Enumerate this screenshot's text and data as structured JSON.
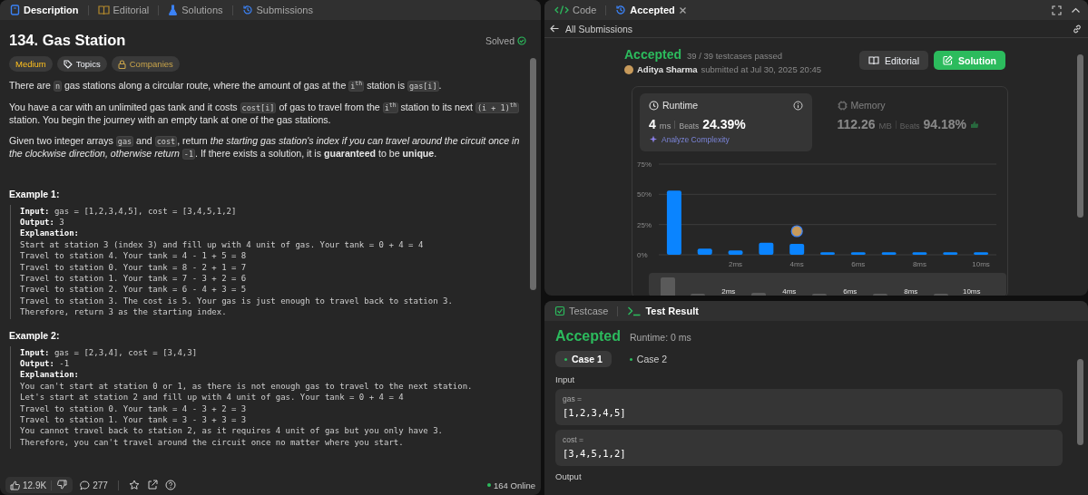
{
  "left_panel": {
    "tabs": [
      {
        "label": "Description",
        "selected": true,
        "kind": "description"
      },
      {
        "label": "Editorial",
        "selected": false,
        "kind": "editorial"
      },
      {
        "label": "Solutions",
        "selected": false,
        "kind": "solutions"
      },
      {
        "label": "Submissions",
        "selected": false,
        "kind": "submissions"
      }
    ],
    "problem": {
      "title": "134. Gas Station",
      "status": "Solved",
      "tags": [
        {
          "label": "Medium",
          "kind": "difficulty"
        },
        {
          "label": "Topics",
          "kind": "topics"
        },
        {
          "label": "Companies",
          "kind": "companies"
        }
      ],
      "paragraphs": [
        [
          {
            "kind": "text",
            "text": "There are "
          },
          {
            "kind": "code",
            "text": "n"
          },
          {
            "kind": "text",
            "text": " gas stations along a circular route, where the amount of gas at the "
          },
          {
            "kind": "code",
            "text": "i$^{th}$"
          },
          {
            "kind": "text",
            "text": " station is "
          },
          {
            "kind": "code",
            "text": "gas[i]"
          },
          {
            "kind": "text",
            "text": "."
          }
        ],
        [
          {
            "kind": "text",
            "text": "You have a car with an unlimited gas tank and it costs "
          },
          {
            "kind": "code",
            "text": "cost[i]"
          },
          {
            "kind": "text",
            "text": " of gas to travel from the "
          },
          {
            "kind": "code",
            "text": "i$^{th}$"
          },
          {
            "kind": "text",
            "text": " station to its next "
          },
          {
            "kind": "code",
            "text": "(i + 1)$^{th}$"
          },
          {
            "kind": "text",
            "text": " station. You begin the journey with an empty tank at one of the gas stations."
          }
        ],
        [
          {
            "kind": "text",
            "text": "Given two integer arrays "
          },
          {
            "kind": "code",
            "text": "gas"
          },
          {
            "kind": "text",
            "text": " and "
          },
          {
            "kind": "code",
            "text": "cost"
          },
          {
            "kind": "text",
            "text": ", return *the starting gas station's index if you can travel around the circuit once in the clockwise direction, otherwise return* "
          },
          {
            "kind": "code",
            "text": "-1"
          },
          {
            "kind": "text",
            "text": ". If there exists a solution, it is **guaranteed** to be **unique**."
          }
        ]
      ],
      "examples": [
        {
          "heading": "Example 1:",
          "lines": [
            "**Input:** gas = [1,2,3,4,5], cost = [3,4,5,1,2]",
            "**Output:** 3",
            "**Explanation:**",
            "Start at station 3 (index 3) and fill up with 4 unit of gas. Your tank = 0 + 4 = 4",
            "Travel to station 4. Your tank = 4 - 1 + 5 = 8",
            "Travel to station 0. Your tank = 8 - 2 + 1 = 7",
            "Travel to station 1. Your tank = 7 - 3 + 2 = 6",
            "Travel to station 2. Your tank = 6 - 4 + 3 = 5",
            "Travel to station 3. The cost is 5. Your gas is just enough to travel back to station 3.",
            "Therefore, return 3 as the starting index."
          ]
        },
        {
          "heading": "Example 2:",
          "lines": [
            "**Input:** gas = [2,3,4], cost = [3,4,3]",
            "**Output:** -1",
            "**Explanation:**",
            "You can't start at station 0 or 1, as there is not enough gas to travel to the next station.",
            "Let's start at station 2 and fill up with 4 unit of gas. Your tank = 0 + 4 = 4",
            "Travel to station 0. Your tank = 4 - 3 + 2 = 3",
            "Travel to station 1. Your tank = 3 - 3 + 3 = 3",
            "You cannot travel back to station 2, as it requires 4 unit of gas but you only have 3.",
            "Therefore, you can't travel around the circuit once no matter where you start."
          ]
        }
      ]
    },
    "footer": {
      "likes": "12.9K",
      "comments": "277",
      "online": "164 Online"
    }
  },
  "right_panel": {
    "tabs": [
      {
        "label": "Code",
        "selected": false,
        "kind": "code"
      },
      {
        "label": "Accepted",
        "selected": true,
        "kind": "result"
      }
    ],
    "back_link": "All Submissions",
    "submission": {
      "status": "Accepted",
      "passed": "39 / 39 testcases passed",
      "author": "Aditya Sharma",
      "submitted": "submitted at Jul 30, 2025 20:45",
      "buttons": [
        {
          "label": "Editorial",
          "kind": "secondary"
        },
        {
          "label": "Solution",
          "kind": "primary"
        }
      ],
      "metrics": [
        {
          "label": "Runtime",
          "kind": "runtime",
          "value": "4",
          "unit": "ms",
          "beats_label": "Beats",
          "beats": "24.39%",
          "selected": true,
          "link": "Analyze Complexity"
        },
        {
          "label": "Memory",
          "kind": "memory",
          "value": "112.26",
          "unit": "MB",
          "beats_label": "Beats",
          "beats": "94.18%",
          "selected": false
        }
      ],
      "chart_data": {
        "type": "bar",
        "x": [
          0,
          1,
          2,
          3,
          4,
          5,
          6,
          7,
          8,
          9,
          10
        ],
        "values": [
          53,
          5,
          3.5,
          10,
          9,
          2,
          2,
          2,
          2,
          2,
          2
        ],
        "xlim": [
          -0.5,
          10.5
        ],
        "ylim": [
          0,
          75
        ],
        "yticks": [
          {
            "value": 0,
            "label": "0%"
          },
          {
            "value": 25,
            "label": "25%"
          },
          {
            "value": 50,
            "label": "50%"
          },
          {
            "value": 75,
            "label": "75%"
          }
        ],
        "xticks": [
          {
            "value": 2,
            "label": "2ms"
          },
          {
            "value": 4,
            "label": "4ms"
          },
          {
            "value": 6,
            "label": "6ms"
          },
          {
            "value": 8,
            "label": "8ms"
          },
          {
            "value": 10,
            "label": "10ms"
          }
        ]
      },
      "navigator_labels": [
        "2ms",
        "4ms",
        "6ms",
        "8ms",
        "10ms"
      ]
    }
  },
  "test_panel": {
    "tabs": [
      {
        "label": "Testcase",
        "selected": false,
        "kind": "testcase"
      },
      {
        "label": "Test Result",
        "selected": true,
        "kind": "result"
      }
    ],
    "status": "Accepted",
    "runtime": "Runtime: 0 ms",
    "cases": [
      {
        "label": "Case 1",
        "selected": true
      },
      {
        "label": "Case 2",
        "selected": false
      }
    ],
    "input_label": "Input",
    "inputs": [
      {
        "name": "gas =",
        "value": "[1,2,3,4,5]"
      },
      {
        "name": "cost =",
        "value": "[3,4,5,1,2]"
      }
    ],
    "output_label": "Output"
  }
}
